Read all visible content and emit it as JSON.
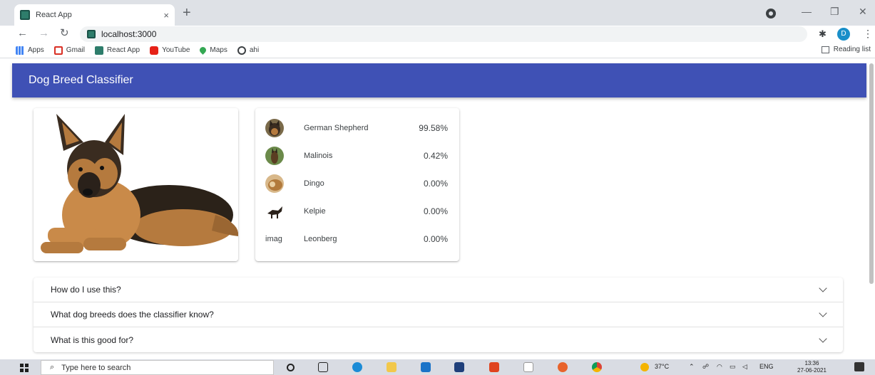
{
  "browser": {
    "tab_title": "React App",
    "tab_close": "×",
    "new_tab": "+",
    "url": "localhost:3000",
    "avatar_letter": "D",
    "bookmarks": [
      "Apps",
      "Gmail",
      "React App",
      "YouTube",
      "Maps",
      "ahi"
    ],
    "reading_list": "Reading list"
  },
  "app": {
    "title": "Dog Breed Classifier"
  },
  "results": [
    {
      "breed": "German Shepherd",
      "percent": "99.58%"
    },
    {
      "breed": "Malinois",
      "percent": "0.42%"
    },
    {
      "breed": "Dingo",
      "percent": "0.00%"
    },
    {
      "breed": "Kelpie",
      "percent": "0.00%"
    },
    {
      "breed": "Leonberg",
      "percent": "0.00%"
    }
  ],
  "broken_image_alt": "imag",
  "faq": [
    "How do I use this?",
    "What dog breeds does the classifier know?",
    "What is this good for?"
  ],
  "taskbar": {
    "search_placeholder": "Type here to search",
    "temperature": "37°C",
    "language": "ENG",
    "time": "13:36",
    "date": "27-06-2021"
  },
  "colors": {
    "appbar": "#3f51b5"
  }
}
